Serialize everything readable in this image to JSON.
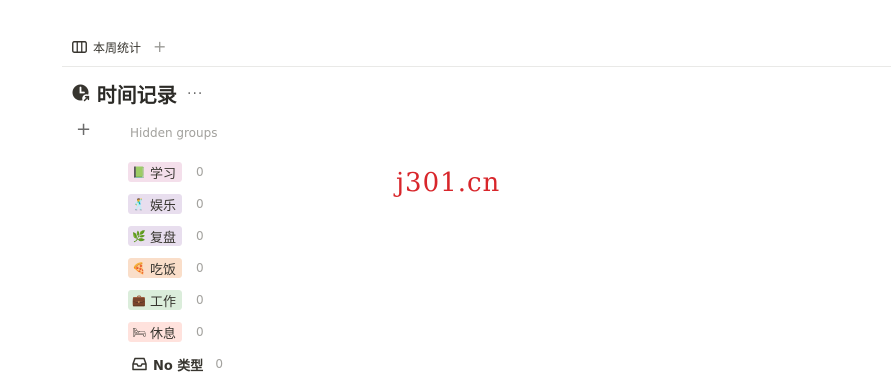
{
  "view_tabs": {
    "active_tab_label": "本周统计",
    "board_icon": "board-columns-icon",
    "add_view_icon": "plus-icon"
  },
  "database": {
    "title": "时间记录",
    "title_icon": "clock-arrow-icon",
    "more_label": "···"
  },
  "group_controls": {
    "add_icon": "plus-icon",
    "hidden_groups_label": "Hidden groups"
  },
  "groups": [
    {
      "emoji": "📗",
      "label": "学习",
      "count": "0",
      "bg": "#f4dfeb"
    },
    {
      "emoji": "🕺",
      "label": "娱乐",
      "count": "0",
      "bg": "#e8deee"
    },
    {
      "emoji": "🌿",
      "label": "复盘",
      "count": "0",
      "bg": "#e8deee"
    },
    {
      "emoji": "🍕",
      "label": "吃饭",
      "count": "0",
      "bg": "#fadec9"
    },
    {
      "emoji": "💼",
      "label": "工作",
      "count": "0",
      "bg": "#dbeddb"
    },
    {
      "emoji": "🛏",
      "label": "休息",
      "count": "0",
      "bg": "#ffe2dd"
    }
  ],
  "no_type_group": {
    "icon": "inbox-icon",
    "label": "No 类型",
    "count": "0"
  },
  "watermark": "j301.cn"
}
